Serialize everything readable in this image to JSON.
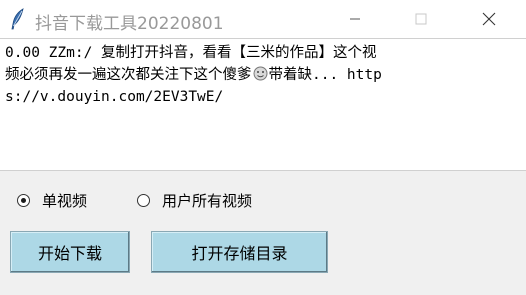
{
  "window": {
    "title": "抖音下载工具20220801",
    "icon": "feather-icon"
  },
  "titlebar_controls": {
    "minimize_icon": "minimize-icon",
    "maximize_icon": "maximize-icon",
    "close_icon": "close-icon"
  },
  "textbox": {
    "lines": [
      "0.00 ZZm:/ 复制打开抖音，看看【三米的作品】这个视",
      "频必须再发一遍这次都关注下这个傻爹",
      "s://v.douyin.com/2EV3TwE/"
    ],
    "line2_tail": "带着缺... http",
    "emoji_icon": "emoji-icon"
  },
  "options": {
    "single_video_label": "单视频",
    "all_videos_label": "用户所有视频",
    "selected": "单视频"
  },
  "buttons": {
    "download_label": "开始下载",
    "open_dir_label": "打开存储目录"
  },
  "colors": {
    "button_bg": "#add8e6",
    "title_text": "#999999",
    "window_bg": "#f0f0f0"
  }
}
